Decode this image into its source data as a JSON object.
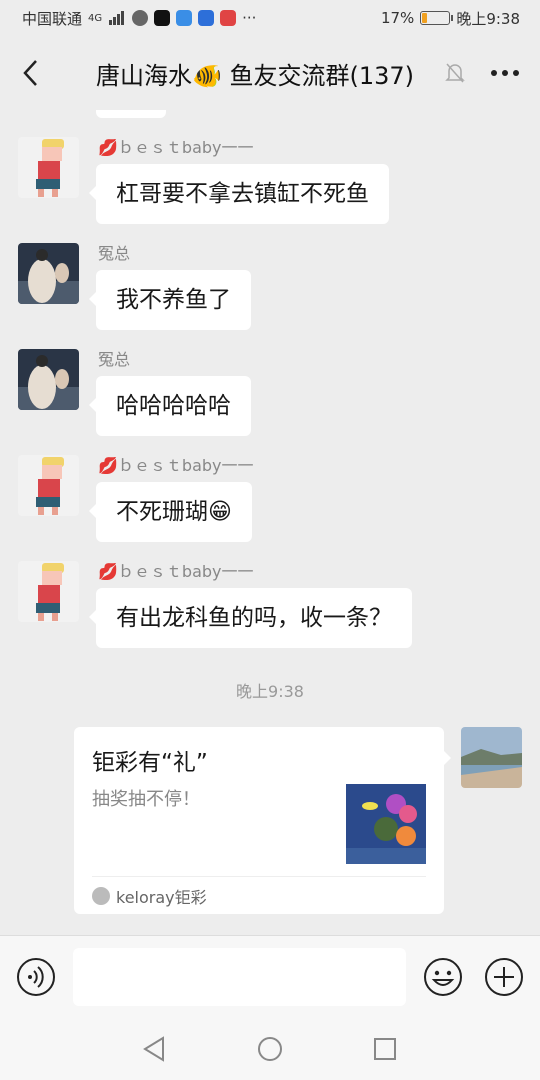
{
  "status_bar": {
    "carrier": "中国联通",
    "network": "4G",
    "battery_percent": "17%",
    "battery_level": 0.17,
    "time": "晚上9:38",
    "more": "···"
  },
  "header": {
    "title": "唐山海水🐠 鱼友交流群(137)",
    "back_icon": "chevron-left-icon",
    "mute_icon": "bell-off-icon",
    "more_icon": "more-dots-icon"
  },
  "messages": [
    {
      "sender": "💋ｂｅｓｔbaby一一",
      "text": "杠哥要不拿去镇缸不死鱼",
      "avatar": "cartoon-avatar"
    },
    {
      "sender": "冤总",
      "text": "我不养鱼了",
      "avatar": "photo-avatar"
    },
    {
      "sender": "冤总",
      "text": "哈哈哈哈哈",
      "avatar": "photo-avatar"
    },
    {
      "sender": "💋ｂｅｓｔbaby一一",
      "text": "不死珊瑚😁",
      "avatar": "cartoon-avatar"
    },
    {
      "sender": "💋ｂｅｓｔbaby一一",
      "text": "有出龙科鱼的吗，收一条？",
      "avatar": "cartoon-avatar"
    }
  ],
  "timestamp": "晚上9:38",
  "share_card": {
    "title": "钜彩有“礼”",
    "description": "抽奖抽不停！",
    "source": "keloray钜彩",
    "thumbnail": "coral-reef-thumbnail"
  },
  "input_bar": {
    "voice_icon": "voice-icon",
    "emoji_icon": "emoji-icon",
    "plus_icon": "plus-icon",
    "text": ""
  },
  "nav_bar": {
    "back_icon": "triangle-back-icon",
    "home_icon": "circle-home-icon",
    "recent_icon": "square-recent-icon"
  },
  "colors": {
    "chat_bg": "#ededed",
    "bubble": "#ffffff",
    "muted_text": "#888888",
    "battery_low": "#f0a020"
  }
}
